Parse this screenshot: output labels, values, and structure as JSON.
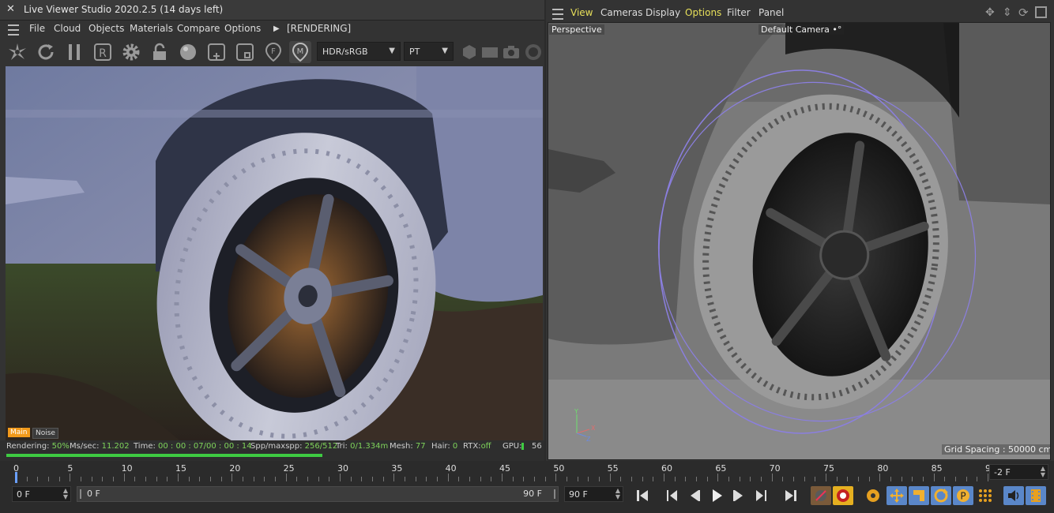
{
  "live_viewer": {
    "title": "Live Viewer Studio 2020.2.5 (14 days left)",
    "close_glyph": "✕",
    "menu": [
      "File",
      "Cloud",
      "Objects",
      "Materials",
      "Compare",
      "Options"
    ],
    "render_state": "[RENDERING]",
    "toolbar": {
      "color_space": "HDR/sRGB",
      "kernel": "PT"
    },
    "view_tabs": [
      "Main",
      "Noise"
    ],
    "status": {
      "rendering_label": "Rendering:",
      "rendering_value": "50%",
      "progress": 0.5,
      "ms_label": "Ms/sec:",
      "ms_value": "11.202",
      "time_label": "Time:",
      "time_value": "00 : 00 : 07/00 : 00 : 14",
      "spp_label": "Spp/maxspp:",
      "spp_value": "256/512",
      "tri_label": "Tri:",
      "tri_value": "0/1.334m",
      "mesh_label": "Mesh:",
      "mesh_value": "77",
      "hair_label": "Hair:",
      "hair_value": "0",
      "rtx_label": "RTX:",
      "rtx_value": "off",
      "gpu_label": "GPU:",
      "gpu_value": "56"
    }
  },
  "viewport": {
    "menu": [
      "View",
      "Cameras",
      "Display",
      "Options",
      "Filter",
      "Panel"
    ],
    "active_menu_color": "#e8e05a",
    "projection_label": "Perspective",
    "camera_label": "Default Camera",
    "camera_glyph": "•°",
    "grid_spacing": "Grid Spacing : 50000 cm",
    "axis_labels": [
      "Y",
      "Z",
      "X"
    ]
  },
  "timeline": {
    "ticks": [
      0,
      5,
      10,
      15,
      20,
      25,
      30,
      35,
      40,
      45,
      50,
      55,
      60,
      65,
      70,
      75,
      80,
      85,
      90
    ],
    "max_frame": 90,
    "current_frame_field": "-2 F",
    "start_field": "0 F",
    "range_start": "0 F",
    "range_end": "90 F",
    "end_field": "90 F"
  },
  "colors": {
    "accent_green": "#3ecb42",
    "main_tab": "#f29a1b",
    "timeline_selection": "#5a87c9"
  }
}
